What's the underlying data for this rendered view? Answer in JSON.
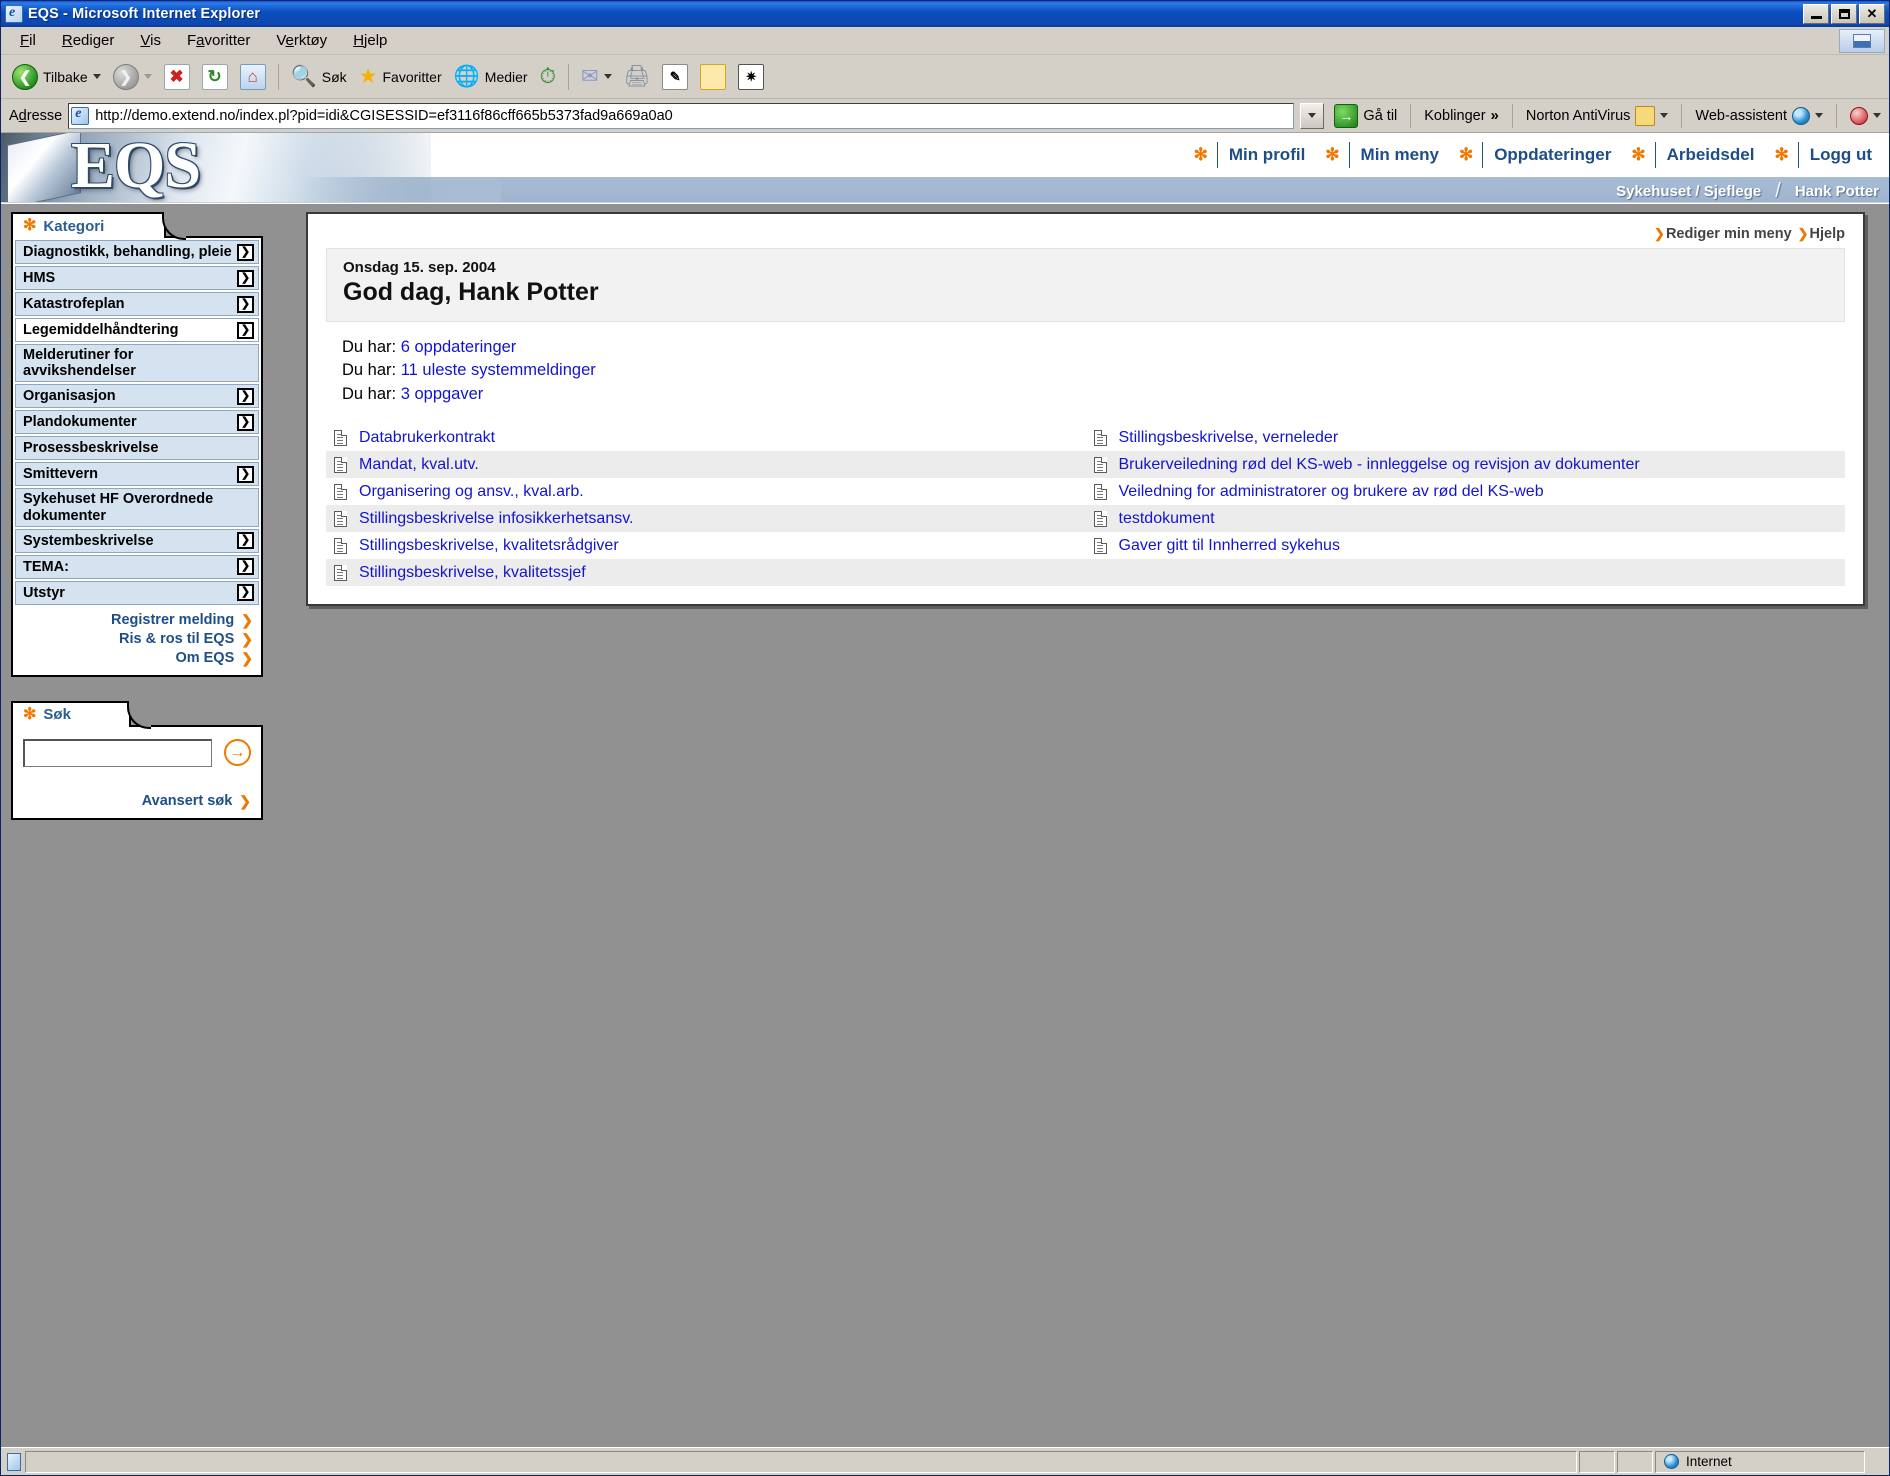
{
  "window": {
    "title": "EQS - Microsoft Internet Explorer",
    "icon": "ie-page-icon",
    "minimize_label": "–",
    "maximize_label": "❐",
    "close_label": "✕"
  },
  "menubar": {
    "items": [
      {
        "label": "Fil",
        "accel": "F"
      },
      {
        "label": "Rediger",
        "accel": "R"
      },
      {
        "label": "Vis",
        "accel": "V"
      },
      {
        "label": "Favoritter",
        "accel": "a"
      },
      {
        "label": "Verktøy",
        "accel": "e"
      },
      {
        "label": "Hjelp",
        "accel": "H"
      }
    ]
  },
  "toolbar": {
    "back_label": "Tilbake",
    "forward_label": "",
    "stop_label": "✖",
    "refresh_label": "⟳",
    "home_label": "⌂",
    "search_label": "Søk",
    "favorites_label": "Favoritter",
    "media_label": "Medier",
    "history_label": "⏱",
    "mail_label": "✉",
    "print_label": "⎙",
    "edit_label": "✎",
    "note_label": "□",
    "messenger_label": "✻"
  },
  "address": {
    "label": "Adresse",
    "url": "http://demo.extend.no/index.pl?pid=idi&CGISESSID=ef3116f86cff665b5373fad9a669a0a0",
    "placeholder": "",
    "go_label": "Gå til",
    "links_label": "Koblinger",
    "links_chevron": "»",
    "norton_label": "Norton AntiVirus",
    "webassistent_label": "Web-assistent"
  },
  "banner": {
    "logo": "EQS",
    "nav": [
      {
        "label": "Min profil"
      },
      {
        "label": "Min meny"
      },
      {
        "label": "Oppdateringer"
      },
      {
        "label": "Arbeidsdel"
      },
      {
        "label": "Logg ut"
      }
    ],
    "star": "✻",
    "breadcrumb_org": "Sykehuset / Sjeflege",
    "breadcrumb_user": "Hank Potter"
  },
  "sidebar": {
    "category_panel": {
      "title": "Kategori",
      "star": "✻",
      "items": [
        {
          "label": "Diagnostikk, behandling, pleie",
          "arrow": true,
          "hover": false
        },
        {
          "label": "HMS",
          "arrow": true,
          "hover": false
        },
        {
          "label": "Katastrofeplan",
          "arrow": true,
          "hover": false
        },
        {
          "label": "Legemiddelhåndtering",
          "arrow": true,
          "hover": true
        },
        {
          "label": "Melderutiner for avvikshendelser",
          "arrow": false,
          "hover": false
        },
        {
          "label": "Organisasjon",
          "arrow": true,
          "hover": false
        },
        {
          "label": "Plandokumenter",
          "arrow": true,
          "hover": false
        },
        {
          "label": "Prosessbeskrivelse",
          "arrow": false,
          "hover": false
        },
        {
          "label": "Smittevern",
          "arrow": true,
          "hover": false
        },
        {
          "label": "Sykehuset HF Overordnede dokumenter",
          "arrow": false,
          "hover": false
        },
        {
          "label": "Systembeskrivelse",
          "arrow": true,
          "hover": false
        },
        {
          "label": "TEMA:",
          "arrow": true,
          "hover": false
        },
        {
          "label": "Utstyr",
          "arrow": true,
          "hover": false
        }
      ],
      "quick_links": [
        {
          "label": "Registrer melding",
          "marker": "❯"
        },
        {
          "label": "Ris & ros til EQS",
          "marker": "❯"
        },
        {
          "label": "Om EQS",
          "marker": "❯"
        }
      ]
    },
    "search_panel": {
      "title": "Søk",
      "star": "✻",
      "input_value": "",
      "input_placeholder": "",
      "go_icon": "→",
      "advanced_label": "Avansert søk",
      "advanced_marker": "❯"
    }
  },
  "main": {
    "edit_menu_link": "Rediger min meny",
    "help_link": "Hjelp",
    "link_marker": "❯",
    "date": "Onsdag 15. sep. 2004",
    "greeting": "God dag, Hank Potter",
    "counts": [
      {
        "prefix": "Du har: ",
        "link": "6 oppdateringer"
      },
      {
        "prefix": "Du har: ",
        "link": "11 uleste systemmeldinger"
      },
      {
        "prefix": "Du har: ",
        "link": "3 oppgaver"
      }
    ],
    "documents_left": [
      {
        "label": "Databrukerkontrakt",
        "alt": false
      },
      {
        "label": "Mandat, kval.utv.",
        "alt": true
      },
      {
        "label": "Organisering og ansv., kval.arb.",
        "alt": false
      },
      {
        "label": "Stillingsbeskrivelse infosikkerhetsansv.",
        "alt": true
      },
      {
        "label": "Stillingsbeskrivelse, kvalitetsrådgiver",
        "alt": false
      },
      {
        "label": "Stillingsbeskrivelse, kvalitetssjef",
        "alt": true
      }
    ],
    "documents_right": [
      {
        "label": "Stillingsbeskrivelse, verneleder",
        "alt": false
      },
      {
        "label": "Brukerveiledning rød del KS-web - innleggelse og revisjon av dokumenter",
        "alt": true
      },
      {
        "label": "Veiledning for administratorer og brukere av rød del KS-web",
        "alt": false
      },
      {
        "label": "testdokument",
        "alt": true
      },
      {
        "label": "Gaver gitt til Innherred sykehus",
        "alt": false
      },
      {
        "label": "",
        "alt": true
      }
    ]
  },
  "statusbar": {
    "message": "",
    "zone": "Internet",
    "zone_icon": "globe-icon"
  },
  "colors": {
    "accent_orange": "#f07800",
    "link_blue": "#1414d0",
    "nav_blue": "#1f4e87",
    "banner_blue": "#a8bcd4",
    "category_bg": "#d5e2f0",
    "titlebar_blue": "#0d47b0"
  }
}
